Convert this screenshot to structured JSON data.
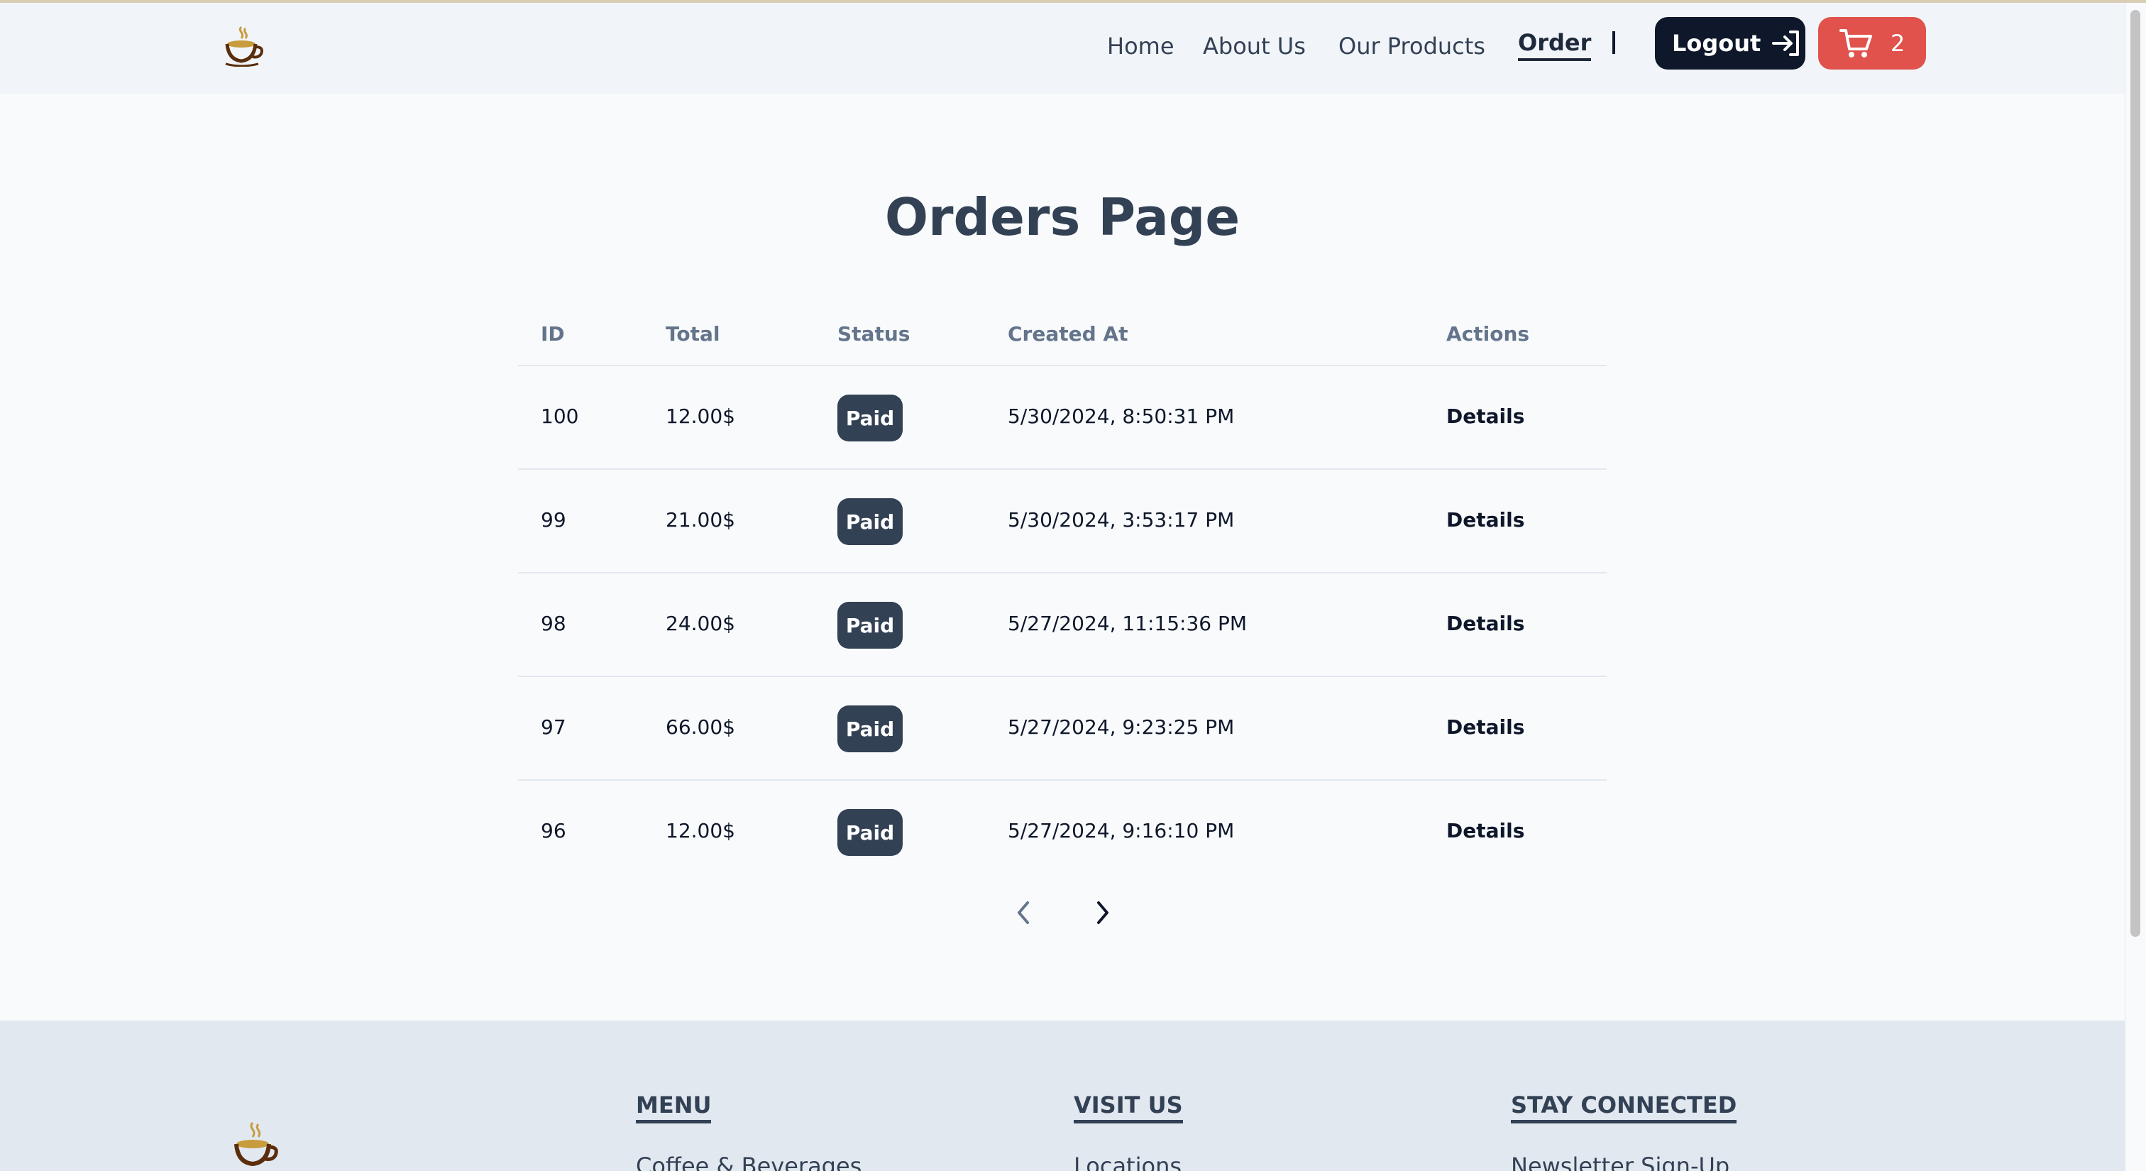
{
  "nav": {
    "links": [
      "Home",
      "About Us",
      "Our Products",
      "Order"
    ],
    "active": "Order",
    "separator": "|",
    "logout_label": "Logout",
    "cart_count": "2",
    "accent_cart": "#e0524b",
    "accent_dark": "#0f172a"
  },
  "main": {
    "title": "Orders Page",
    "columns": [
      "ID",
      "Total",
      "Status",
      "Created At",
      "Actions"
    ],
    "rows": [
      {
        "id": "100",
        "total": "12.00$",
        "status": "Paid",
        "created": "5/30/2024, 8:50:31 PM",
        "action": "Details"
      },
      {
        "id": "99",
        "total": "21.00$",
        "status": "Paid",
        "created": "5/30/2024, 3:53:17 PM",
        "action": "Details"
      },
      {
        "id": "98",
        "total": "24.00$",
        "status": "Paid",
        "created": "5/27/2024, 11:15:36 PM",
        "action": "Details"
      },
      {
        "id": "97",
        "total": "66.00$",
        "status": "Paid",
        "created": "5/27/2024, 9:23:25 PM",
        "action": "Details"
      },
      {
        "id": "96",
        "total": "12.00$",
        "status": "Paid",
        "created": "5/27/2024, 9:16:10 PM",
        "action": "Details"
      }
    ],
    "pager": {
      "prev_icon": "chevron-left-icon",
      "next_icon": "chevron-right-icon"
    }
  },
  "footer": {
    "columns": [
      {
        "heading": "MENU",
        "first_link": "Coffee & Beverages"
      },
      {
        "heading": "VISIT US",
        "first_link": "Locations"
      },
      {
        "heading": "STAY CONNECTED",
        "first_link": "Newsletter Sign-Up"
      }
    ]
  }
}
